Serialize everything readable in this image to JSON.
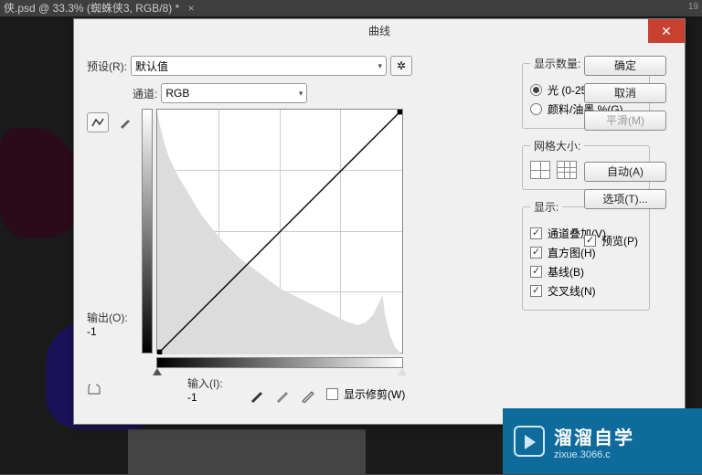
{
  "app": {
    "tab_title": "侠.psd @ 33.3% (蜘蛛侠3, RGB/8) *",
    "ruler_num": "19"
  },
  "dialog": {
    "title": "曲线",
    "preset_label": "预设(R):",
    "preset_value": "默认值",
    "channel_label": "通道:",
    "channel_value": "RGB",
    "output_label": "输出(O):",
    "output_value": "-1",
    "input_label": "输入(I):",
    "input_value": "-1",
    "show_clipping": "显示修剪(W)"
  },
  "buttons": {
    "ok": "确定",
    "cancel": "取消",
    "smooth": "平滑(M)",
    "auto": "自动(A)",
    "options": "选项(T)...",
    "preview": "预览(P)"
  },
  "groups": {
    "display_amount": {
      "legend": "显示数量:",
      "light": "光 (0-255)(L)",
      "pigment": "颜料/油墨 %(G)"
    },
    "grid_size": {
      "legend": "网格大小:"
    },
    "display": {
      "legend": "显示:",
      "overlay": "通道叠加(V)",
      "histogram": "直方图(H)",
      "baseline": "基线(B)",
      "intersection": "交叉线(N)"
    }
  },
  "chart_data": {
    "type": "line",
    "title": "曲线",
    "xlabel": "输入",
    "ylabel": "输出",
    "xlim": [
      0,
      255
    ],
    "ylim": [
      0,
      255
    ],
    "series": [
      {
        "name": "RGB",
        "x": [
          0,
          255
        ],
        "y": [
          0,
          255
        ]
      }
    ],
    "histogram_shape_approx": [
      255,
      240,
      230,
      220,
      210,
      205,
      198,
      190,
      182,
      175,
      168,
      160,
      152,
      145,
      138,
      132,
      125,
      118,
      112,
      105,
      100,
      95,
      90,
      85,
      80,
      76,
      72,
      68,
      64,
      60,
      57,
      54,
      51,
      48,
      45,
      42,
      40,
      38,
      36,
      34,
      32,
      30,
      28,
      27,
      26,
      25,
      24,
      23,
      22,
      21,
      20,
      19,
      18,
      17,
      16,
      16,
      15,
      15,
      14,
      14,
      13,
      13,
      12,
      12,
      11,
      11,
      10,
      10,
      10,
      9,
      9,
      9,
      8,
      8,
      8,
      8,
      8,
      7,
      7,
      7,
      7,
      7,
      7,
      7,
      7,
      8,
      8,
      9,
      10,
      12,
      14,
      18,
      22,
      16,
      10,
      6,
      4,
      2,
      1,
      0
    ]
  },
  "watermark": {
    "brand": "溜溜自学",
    "sub": "zixue.3066.c"
  }
}
